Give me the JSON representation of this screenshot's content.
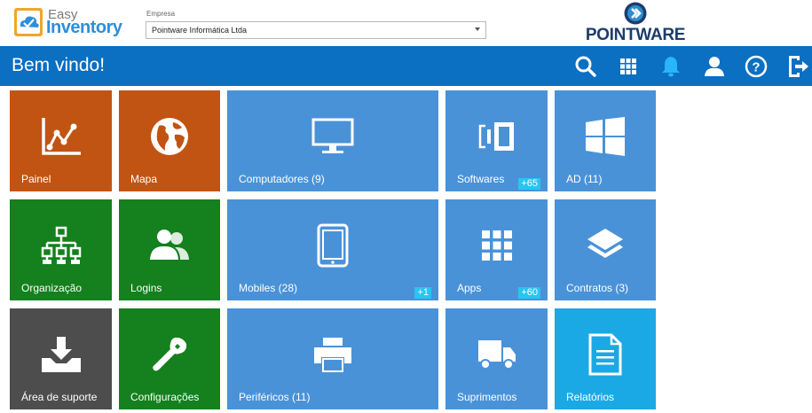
{
  "header": {
    "logo_line1": "Easy",
    "logo_line2": "Inventory",
    "empresa_label": "Empresa",
    "empresa_value": "Pointware Informática Ltda",
    "brand_logo": "POINTWARE"
  },
  "navbar": {
    "title": "Bem vindo!",
    "icons": [
      "search-icon",
      "apps-grid-icon",
      "bell-icon",
      "user-icon",
      "help-icon",
      "logout-icon"
    ]
  },
  "tiles": {
    "painel": {
      "label": "Painel"
    },
    "mapa": {
      "label": "Mapa"
    },
    "computadores": {
      "label": "Computadores (9)"
    },
    "softwares": {
      "label": "Softwares",
      "badge": "+65"
    },
    "ad": {
      "label": "AD (11)"
    },
    "organizacao": {
      "label": "Organização"
    },
    "logins": {
      "label": "Logins"
    },
    "mobiles": {
      "label": "Mobiles (28)",
      "badge": "+1"
    },
    "apps": {
      "label": "Apps",
      "badge": "+60"
    },
    "contratos": {
      "label": "Contratos (3)"
    },
    "suporte": {
      "label": "Área de suporte"
    },
    "configuracoes": {
      "label": "Configurações"
    },
    "perifericos": {
      "label": "Periféricos (11)"
    },
    "suprimentos": {
      "label": "Suprimentos"
    },
    "relatorios": {
      "label": "Relatórios"
    }
  },
  "colors": {
    "navbar": "#0b6fc2",
    "orange": "#c15412",
    "green": "#14801e",
    "gray": "#4d4d4d",
    "blue": "#4a92d8",
    "cyan": "#1ba9e6",
    "badge": "#26c6f0",
    "bell_accent": "#29b6f6"
  }
}
